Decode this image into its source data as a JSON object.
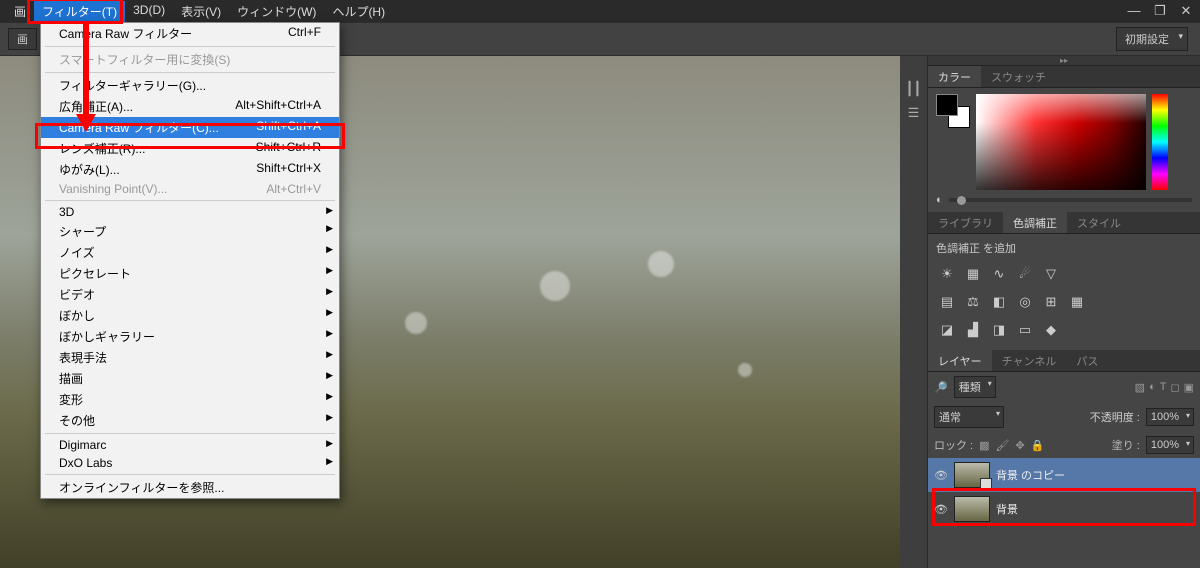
{
  "menubar": {
    "items": [
      "画",
      "フィルター(T)",
      "3D(D)",
      "表示(V)",
      "ウィンドウ(W)",
      "ヘルプ(H)"
    ],
    "active_index": 1
  },
  "optionbar": {
    "left_button": "画",
    "preset": "初期設定"
  },
  "filter_menu": {
    "items": [
      {
        "label": "Camera Raw フィルター",
        "shortcut": "Ctrl+F",
        "sep_after": true
      },
      {
        "label": "スマートフィルター用に変換(S)",
        "disabled": true,
        "sep_after": true
      },
      {
        "label": "フィルターギャラリー(G)..."
      },
      {
        "label": "広角補正(A)...",
        "shortcut": "Alt+Shift+Ctrl+A"
      },
      {
        "label": "Camera Raw フィルター(C)...",
        "shortcut": "Shift+Ctrl+A",
        "selected": true
      },
      {
        "label": "レンズ補正(R)...",
        "shortcut": "Shift+Ctrl+R"
      },
      {
        "label": "ゆがみ(L)...",
        "shortcut": "Shift+Ctrl+X"
      },
      {
        "label": "Vanishing Point(V)...",
        "shortcut": "Alt+Ctrl+V",
        "disabled": true,
        "sep_after": true
      },
      {
        "label": "3D",
        "submenu": true
      },
      {
        "label": "シャープ",
        "submenu": true
      },
      {
        "label": "ノイズ",
        "submenu": true
      },
      {
        "label": "ピクセレート",
        "submenu": true
      },
      {
        "label": "ビデオ",
        "submenu": true
      },
      {
        "label": "ぼかし",
        "submenu": true
      },
      {
        "label": "ぼかしギャラリー",
        "submenu": true
      },
      {
        "label": "表現手法",
        "submenu": true
      },
      {
        "label": "描画",
        "submenu": true
      },
      {
        "label": "変形",
        "submenu": true
      },
      {
        "label": "その他",
        "submenu": true,
        "sep_after": true
      },
      {
        "label": "Digimarc",
        "submenu": true
      },
      {
        "label": "DxO Labs",
        "submenu": true,
        "sep_after": true
      },
      {
        "label": "オンラインフィルターを参照..."
      }
    ]
  },
  "panels": {
    "color": {
      "tabs": [
        "カラー",
        "スウォッチ"
      ],
      "active": 0
    },
    "adjust": {
      "tabs": [
        "ライブラリ",
        "色調補正",
        "スタイル"
      ],
      "active": 1,
      "title": "色調補正 を追加"
    },
    "layers": {
      "tabs": [
        "レイヤー",
        "チャンネル",
        "パス"
      ],
      "active": 0,
      "filter_label": "種類",
      "blend": "通常",
      "opacity_label": "不透明度 :",
      "opacity_value": "100%",
      "lock_label": "ロック :",
      "fill_label": "塗り :",
      "fill_value": "100%",
      "rows": [
        {
          "name": "背景 のコピー",
          "selected": true
        },
        {
          "name": "背景"
        }
      ]
    }
  }
}
